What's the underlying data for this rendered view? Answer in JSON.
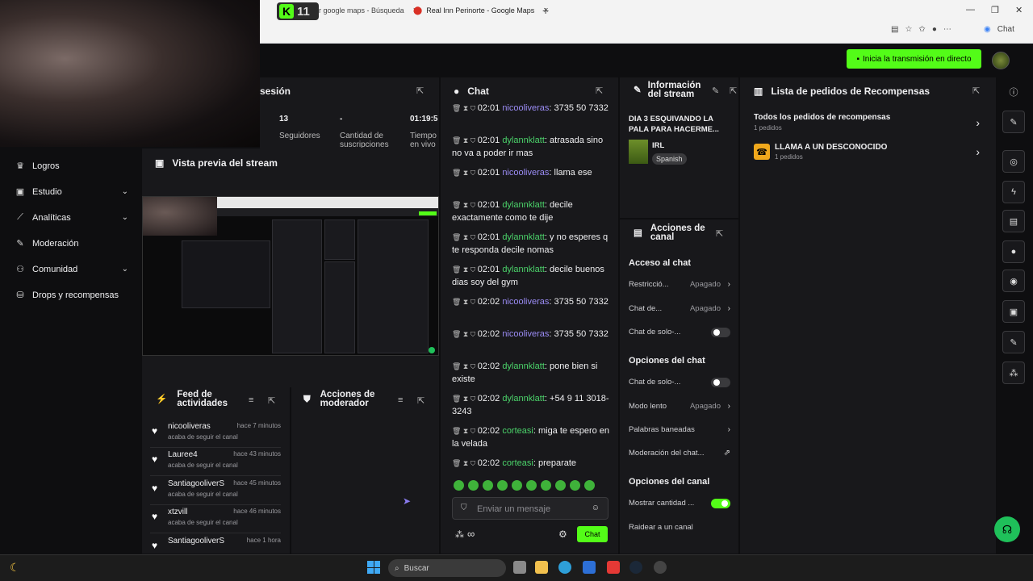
{
  "browser": {
    "tab1_label": "rnar google maps - Búsqueda",
    "tab2_label": "Real Inn Perinorte - Google Maps",
    "tab_close": "×",
    "new_tab": "+",
    "chat_btn": "Chat",
    "minimize": "—",
    "maximize": "❐",
    "close": "✕"
  },
  "kick_badge": {
    "letter": "K",
    "count": "11"
  },
  "topbar": {
    "live_button": "Inicia la transmisión en directo"
  },
  "sidebar": {
    "items": [
      {
        "label": "Logros",
        "icon": "trophy-icon"
      },
      {
        "label": "Estudio",
        "icon": "studio-icon"
      },
      {
        "label": "Analíticas",
        "icon": "analytics-icon"
      },
      {
        "label": "Moderación",
        "icon": "wrench-icon"
      },
      {
        "label": "Comunidad",
        "icon": "community-icon"
      },
      {
        "label": "Drops y recompensas",
        "icon": "drops-icon"
      }
    ]
  },
  "stats": {
    "title": "sesión",
    "col1_value": "13",
    "col1_label": "Seguidores",
    "col2_value": "-",
    "col2_label": "Cantidad de suscripciones",
    "col3_value": "01:19:5",
    "col3_label": "Tiempo en vivo"
  },
  "preview": {
    "title": "Vista previa del stream"
  },
  "feed": {
    "title_line1": "Feed de",
    "title_line2": "actividades",
    "items": [
      {
        "name": "nicooliveras",
        "time": "hace 7 minutos",
        "sub": "acaba de seguir el canal"
      },
      {
        "name": "Lauree4",
        "time": "hace 43 minutos",
        "sub": "acaba de seguir el canal"
      },
      {
        "name": "SantiagooliverS",
        "time": "hace 45 minutos",
        "sub": "acaba de seguir el canal"
      },
      {
        "name": "xtzvill",
        "time": "hace 46 minutos",
        "sub": "acaba de seguir el canal"
      },
      {
        "name": "SantiagooliverS",
        "time": "hace 1 hora",
        "sub": ""
      }
    ]
  },
  "mod_actions": {
    "title_line1": "Acciones de",
    "title_line2": "moderador"
  },
  "chat": {
    "title": "Chat",
    "messages": [
      {
        "time": "02:01",
        "user": "nicooliveras",
        "color": "purple",
        "text": ": 3735 50 7332"
      },
      {
        "time": "02:01",
        "user": "dylannklatt",
        "color": "green",
        "text": ": atrasada sino no va a poder ir mas"
      },
      {
        "time": "02:01",
        "user": "nicooliveras",
        "color": "purple",
        "text": ": llama ese"
      },
      {
        "time": "02:01",
        "user": "dylannklatt",
        "color": "green",
        "text": ": decile exactamente como te dije"
      },
      {
        "time": "02:01",
        "user": "dylannklatt",
        "color": "green",
        "text": ": y no esperes q te responda decile nomas"
      },
      {
        "time": "02:01",
        "user": "dylannklatt",
        "color": "green",
        "text": ": decile buenos dias soy del gym"
      },
      {
        "time": "02:02",
        "user": "nicooliveras",
        "color": "purple",
        "text": ": 3735 50 7332"
      },
      {
        "time": "02:02",
        "user": "nicooliveras",
        "color": "purple",
        "text": ": 3735 50 7332"
      },
      {
        "time": "02:02",
        "user": "dylannklatt",
        "color": "green",
        "text": ": pone bien si existe"
      },
      {
        "time": "02:02",
        "user": "dylannklatt",
        "color": "green",
        "text": ": +54 9 11 3018-3243"
      },
      {
        "time": "02:02",
        "user": "corteasi",
        "color": "green",
        "text": ": miga te espero en la velada"
      },
      {
        "time": "02:02",
        "user": "corteasi",
        "color": "green",
        "text": ": preparate"
      }
    ],
    "input_placeholder": "Enviar un mensaje",
    "send_button": "Chat",
    "infinity": "∞"
  },
  "stream_info": {
    "title_line1": "Información",
    "title_line2": "del stream",
    "stream_title": "DIA 3 ESQUIVANDO LA PALA PARA HACERME...",
    "category": "IRL",
    "language": "Spanish"
  },
  "channel_actions": {
    "title_line1": "Acciones de",
    "title_line2": "canal",
    "section1": "Acceso al chat",
    "rows1": [
      {
        "label": "Restricció...",
        "value": "Apagado",
        "kind": "arrow"
      },
      {
        "label": "Chat de...",
        "value": "Apagado",
        "kind": "arrow"
      },
      {
        "label": "Chat de solo-...",
        "value": "",
        "kind": "toggle-off"
      }
    ],
    "section2": "Opciones del chat",
    "rows2": [
      {
        "label": "Chat de solo-...",
        "value": "",
        "kind": "toggle-off"
      },
      {
        "label": "Modo lento",
        "value": "Apagado",
        "kind": "arrow"
      },
      {
        "label": "Palabras baneadas",
        "value": "",
        "kind": "arrow"
      },
      {
        "label": "Moderación del chat...",
        "value": "",
        "kind": "external"
      }
    ],
    "section3": "Opciones del canal",
    "rows3": [
      {
        "label": "Mostrar cantidad ...",
        "value": "",
        "kind": "toggle-on"
      },
      {
        "label": "Raidear a un canal",
        "value": "",
        "kind": "none"
      }
    ]
  },
  "rewards": {
    "title": "Lista de pedidos de Recompensas",
    "all_label": "Todos los pedidos de recompensas",
    "all_count": "1 pedidos",
    "item_label": "LLAMA A UN DESCONOCIDO",
    "item_count": "1 pedidos"
  },
  "taskbar": {
    "search_placeholder": "Buscar"
  }
}
